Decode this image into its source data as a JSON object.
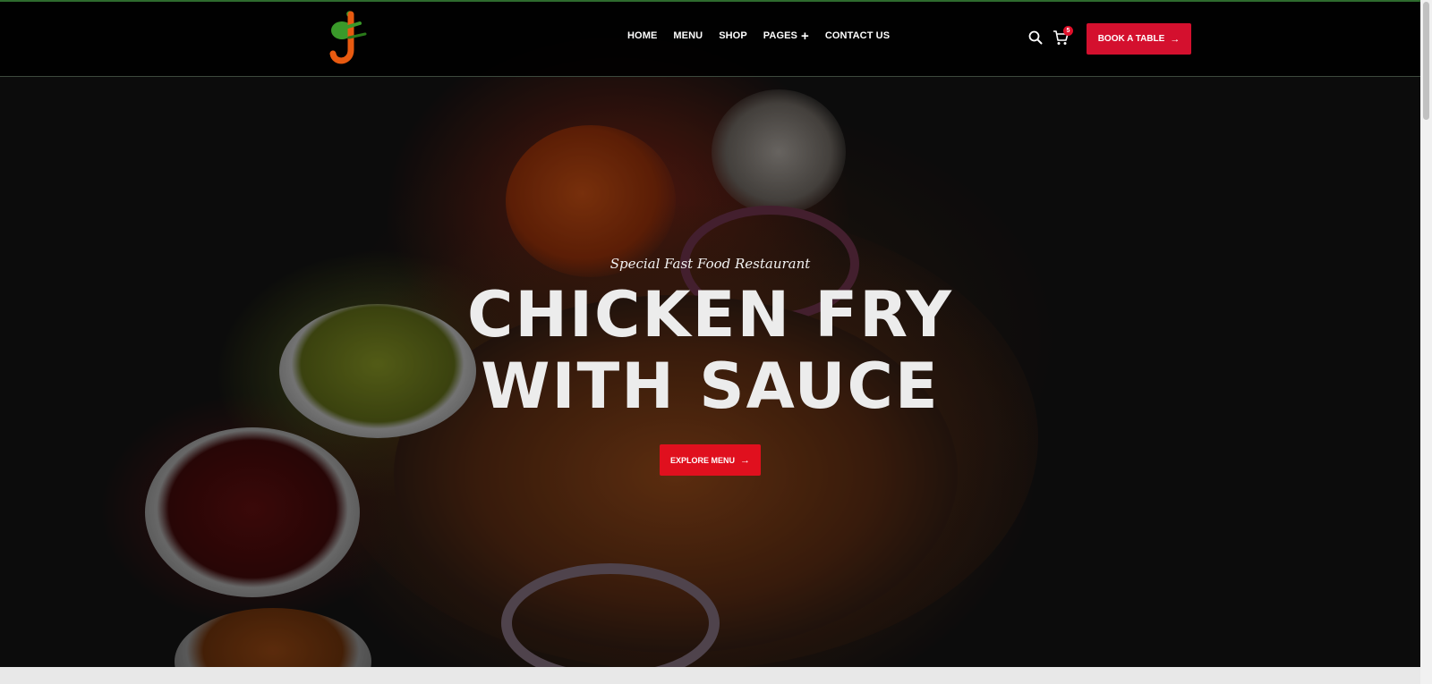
{
  "nav": {
    "items": [
      {
        "label": "HOME"
      },
      {
        "label": "MENU"
      },
      {
        "label": "SHOP"
      },
      {
        "label": "PAGES"
      },
      {
        "label": "CONTACT US"
      }
    ]
  },
  "header": {
    "cart_count": "5",
    "book_label": "BOOK A TABLE",
    "accent_color": "#d4102e"
  },
  "hero": {
    "subtitle": "Special Fast Food Restaurant",
    "title_line1": "CHICKEN FRY",
    "title_line2": "WITH SAUCE",
    "explore_label": "EXPLORE MENU"
  },
  "icons": [
    "logo-icon",
    "search-icon",
    "cart-icon",
    "plus-icon",
    "arrow-right-icon"
  ]
}
